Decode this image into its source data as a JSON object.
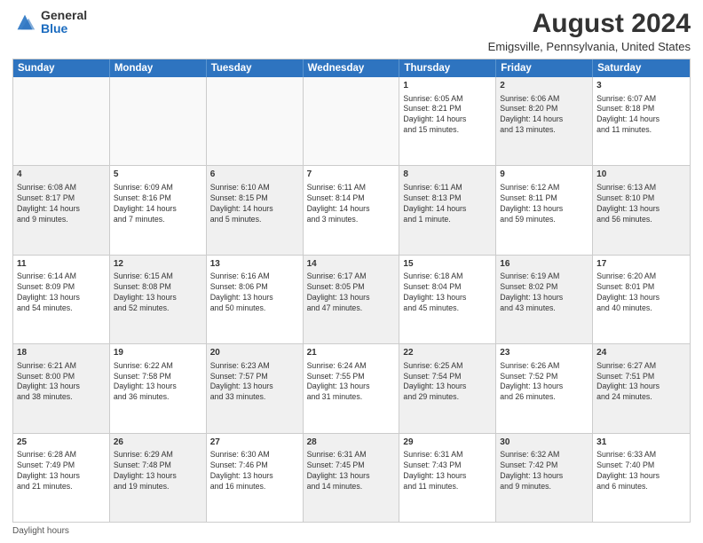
{
  "logo": {
    "text_general": "General",
    "text_blue": "Blue"
  },
  "header": {
    "title": "August 2024",
    "subtitle": "Emigsville, Pennsylvania, United States"
  },
  "weekdays": [
    "Sunday",
    "Monday",
    "Tuesday",
    "Wednesday",
    "Thursday",
    "Friday",
    "Saturday"
  ],
  "rows": [
    [
      {
        "day": "",
        "text": "",
        "shaded": false,
        "empty": true
      },
      {
        "day": "",
        "text": "",
        "shaded": false,
        "empty": true
      },
      {
        "day": "",
        "text": "",
        "shaded": false,
        "empty": true
      },
      {
        "day": "",
        "text": "",
        "shaded": false,
        "empty": true
      },
      {
        "day": "1",
        "text": "Sunrise: 6:05 AM\nSunset: 8:21 PM\nDaylight: 14 hours\nand 15 minutes.",
        "shaded": false,
        "empty": false
      },
      {
        "day": "2",
        "text": "Sunrise: 6:06 AM\nSunset: 8:20 PM\nDaylight: 14 hours\nand 13 minutes.",
        "shaded": true,
        "empty": false
      },
      {
        "day": "3",
        "text": "Sunrise: 6:07 AM\nSunset: 8:18 PM\nDaylight: 14 hours\nand 11 minutes.",
        "shaded": false,
        "empty": false
      }
    ],
    [
      {
        "day": "4",
        "text": "Sunrise: 6:08 AM\nSunset: 8:17 PM\nDaylight: 14 hours\nand 9 minutes.",
        "shaded": true,
        "empty": false
      },
      {
        "day": "5",
        "text": "Sunrise: 6:09 AM\nSunset: 8:16 PM\nDaylight: 14 hours\nand 7 minutes.",
        "shaded": false,
        "empty": false
      },
      {
        "day": "6",
        "text": "Sunrise: 6:10 AM\nSunset: 8:15 PM\nDaylight: 14 hours\nand 5 minutes.",
        "shaded": true,
        "empty": false
      },
      {
        "day": "7",
        "text": "Sunrise: 6:11 AM\nSunset: 8:14 PM\nDaylight: 14 hours\nand 3 minutes.",
        "shaded": false,
        "empty": false
      },
      {
        "day": "8",
        "text": "Sunrise: 6:11 AM\nSunset: 8:13 PM\nDaylight: 14 hours\nand 1 minute.",
        "shaded": true,
        "empty": false
      },
      {
        "day": "9",
        "text": "Sunrise: 6:12 AM\nSunset: 8:11 PM\nDaylight: 13 hours\nand 59 minutes.",
        "shaded": false,
        "empty": false
      },
      {
        "day": "10",
        "text": "Sunrise: 6:13 AM\nSunset: 8:10 PM\nDaylight: 13 hours\nand 56 minutes.",
        "shaded": true,
        "empty": false
      }
    ],
    [
      {
        "day": "11",
        "text": "Sunrise: 6:14 AM\nSunset: 8:09 PM\nDaylight: 13 hours\nand 54 minutes.",
        "shaded": false,
        "empty": false
      },
      {
        "day": "12",
        "text": "Sunrise: 6:15 AM\nSunset: 8:08 PM\nDaylight: 13 hours\nand 52 minutes.",
        "shaded": true,
        "empty": false
      },
      {
        "day": "13",
        "text": "Sunrise: 6:16 AM\nSunset: 8:06 PM\nDaylight: 13 hours\nand 50 minutes.",
        "shaded": false,
        "empty": false
      },
      {
        "day": "14",
        "text": "Sunrise: 6:17 AM\nSunset: 8:05 PM\nDaylight: 13 hours\nand 47 minutes.",
        "shaded": true,
        "empty": false
      },
      {
        "day": "15",
        "text": "Sunrise: 6:18 AM\nSunset: 8:04 PM\nDaylight: 13 hours\nand 45 minutes.",
        "shaded": false,
        "empty": false
      },
      {
        "day": "16",
        "text": "Sunrise: 6:19 AM\nSunset: 8:02 PM\nDaylight: 13 hours\nand 43 minutes.",
        "shaded": true,
        "empty": false
      },
      {
        "day": "17",
        "text": "Sunrise: 6:20 AM\nSunset: 8:01 PM\nDaylight: 13 hours\nand 40 minutes.",
        "shaded": false,
        "empty": false
      }
    ],
    [
      {
        "day": "18",
        "text": "Sunrise: 6:21 AM\nSunset: 8:00 PM\nDaylight: 13 hours\nand 38 minutes.",
        "shaded": true,
        "empty": false
      },
      {
        "day": "19",
        "text": "Sunrise: 6:22 AM\nSunset: 7:58 PM\nDaylight: 13 hours\nand 36 minutes.",
        "shaded": false,
        "empty": false
      },
      {
        "day": "20",
        "text": "Sunrise: 6:23 AM\nSunset: 7:57 PM\nDaylight: 13 hours\nand 33 minutes.",
        "shaded": true,
        "empty": false
      },
      {
        "day": "21",
        "text": "Sunrise: 6:24 AM\nSunset: 7:55 PM\nDaylight: 13 hours\nand 31 minutes.",
        "shaded": false,
        "empty": false
      },
      {
        "day": "22",
        "text": "Sunrise: 6:25 AM\nSunset: 7:54 PM\nDaylight: 13 hours\nand 29 minutes.",
        "shaded": true,
        "empty": false
      },
      {
        "day": "23",
        "text": "Sunrise: 6:26 AM\nSunset: 7:52 PM\nDaylight: 13 hours\nand 26 minutes.",
        "shaded": false,
        "empty": false
      },
      {
        "day": "24",
        "text": "Sunrise: 6:27 AM\nSunset: 7:51 PM\nDaylight: 13 hours\nand 24 minutes.",
        "shaded": true,
        "empty": false
      }
    ],
    [
      {
        "day": "25",
        "text": "Sunrise: 6:28 AM\nSunset: 7:49 PM\nDaylight: 13 hours\nand 21 minutes.",
        "shaded": false,
        "empty": false
      },
      {
        "day": "26",
        "text": "Sunrise: 6:29 AM\nSunset: 7:48 PM\nDaylight: 13 hours\nand 19 minutes.",
        "shaded": true,
        "empty": false
      },
      {
        "day": "27",
        "text": "Sunrise: 6:30 AM\nSunset: 7:46 PM\nDaylight: 13 hours\nand 16 minutes.",
        "shaded": false,
        "empty": false
      },
      {
        "day": "28",
        "text": "Sunrise: 6:31 AM\nSunset: 7:45 PM\nDaylight: 13 hours\nand 14 minutes.",
        "shaded": true,
        "empty": false
      },
      {
        "day": "29",
        "text": "Sunrise: 6:31 AM\nSunset: 7:43 PM\nDaylight: 13 hours\nand 11 minutes.",
        "shaded": false,
        "empty": false
      },
      {
        "day": "30",
        "text": "Sunrise: 6:32 AM\nSunset: 7:42 PM\nDaylight: 13 hours\nand 9 minutes.",
        "shaded": true,
        "empty": false
      },
      {
        "day": "31",
        "text": "Sunrise: 6:33 AM\nSunset: 7:40 PM\nDaylight: 13 hours\nand 6 minutes.",
        "shaded": false,
        "empty": false
      }
    ]
  ],
  "footer": {
    "note": "Daylight hours"
  }
}
